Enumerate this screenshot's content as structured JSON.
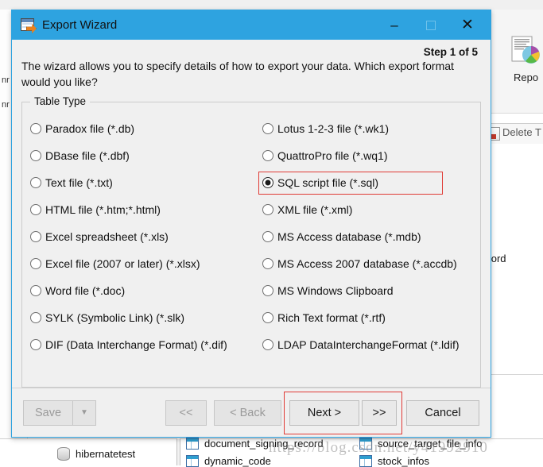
{
  "background": {
    "toolbar": {
      "report_label": "Repo",
      "report_icon": "report-chart-icon"
    },
    "delete_row": {
      "label": "Delete T",
      "icon": "delete-table-icon"
    },
    "grid_fragment": "d",
    "grid_fragment2": "ecord",
    "sidebar_fragments": [
      "nr",
      "nr"
    ],
    "databases": [
      {
        "name": "hibernatetest",
        "icon": "database-icon"
      }
    ],
    "tables_col1": [
      {
        "name": "document_signing_record",
        "icon": "table-icon"
      },
      {
        "name": "dynamic_code",
        "icon": "table-icon"
      }
    ],
    "tables_col2": [
      {
        "name": "source_target_file_info",
        "icon": "table-icon"
      },
      {
        "name": "stock_infos",
        "icon": "table-icon"
      }
    ],
    "watermark": "https://blog.csdn.net/y41992910"
  },
  "dialog": {
    "title": "Export Wizard",
    "title_icon": "export-wizard-icon",
    "window_controls": {
      "minimize": "–",
      "maximize": "maximize-icon",
      "close": "✕"
    },
    "step_label": "Step 1 of 5",
    "intro": "The wizard allows you to specify details of how to export your data. Which export format would you like?",
    "group": {
      "title": "Table Type",
      "options_left": [
        {
          "label": "Paradox file (*.db)",
          "checked": false
        },
        {
          "label": "DBase file (*.dbf)",
          "checked": false
        },
        {
          "label": "Text file (*.txt)",
          "checked": false
        },
        {
          "label": "HTML file (*.htm;*.html)",
          "checked": false
        },
        {
          "label": "Excel spreadsheet (*.xls)",
          "checked": false
        },
        {
          "label": "Excel file (2007 or later) (*.xlsx)",
          "checked": false
        },
        {
          "label": "Word file (*.doc)",
          "checked": false
        },
        {
          "label": "SYLK (Symbolic Link) (*.slk)",
          "checked": false
        },
        {
          "label": "DIF (Data Interchange Format) (*.dif)",
          "checked": false
        }
      ],
      "options_right": [
        {
          "label": "Lotus 1-2-3 file (*.wk1)",
          "checked": false
        },
        {
          "label": "QuattroPro file (*.wq1)",
          "checked": false
        },
        {
          "label": "SQL script file (*.sql)",
          "checked": true
        },
        {
          "label": "XML file (*.xml)",
          "checked": false
        },
        {
          "label": "MS Access database (*.mdb)",
          "checked": false
        },
        {
          "label": "MS Access 2007 database (*.accdb)",
          "checked": false
        },
        {
          "label": "MS Windows Clipboard",
          "checked": false
        },
        {
          "label": "Rich Text format (*.rtf)",
          "checked": false
        },
        {
          "label": "LDAP DataInterchangeFormat (*.ldif)",
          "checked": false
        }
      ],
      "selected_value": "SQL script file (*.sql)"
    },
    "buttons": {
      "save": "Save",
      "save_arrow": "▼",
      "first": "<<",
      "back": "< Back",
      "next": "Next >",
      "last": ">>",
      "cancel": "Cancel"
    }
  },
  "colors": {
    "titlebar": "#2ea3e0",
    "dialog_bg": "#f0f0f0",
    "highlight_red": "#e03b36",
    "accent_orange": "#e8821e"
  }
}
